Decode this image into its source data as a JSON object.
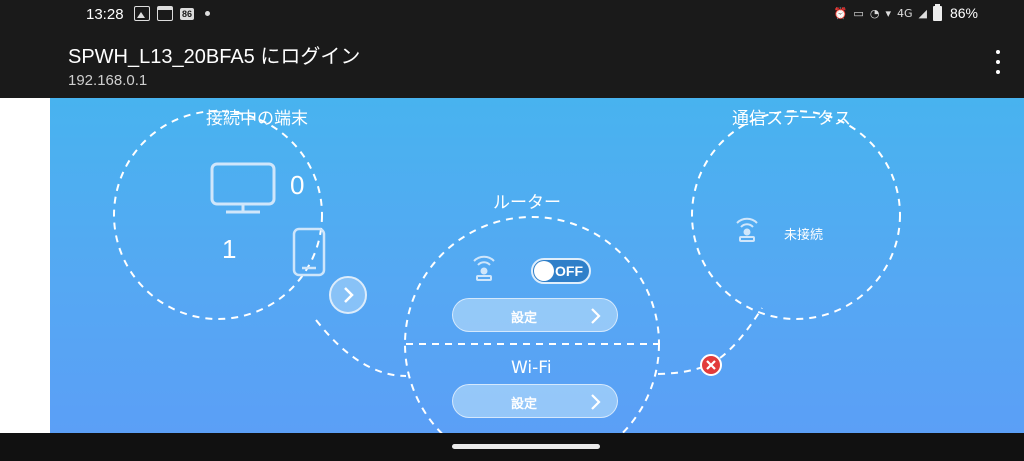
{
  "status_bar": {
    "time": "13:28",
    "badge": "86",
    "network": "4G",
    "battery": "86%"
  },
  "header": {
    "title": "SPWH_L13_20BFA5 にログイン",
    "subtitle": "192.168.0.1"
  },
  "devices": {
    "title": "接続中の端末",
    "pc_count": "0",
    "phone_count": "1"
  },
  "router": {
    "title": "ルーター",
    "toggle_label": "OFF",
    "settings_label": "設定"
  },
  "wifi": {
    "title": "Wi-Fi",
    "settings_label": "設定"
  },
  "status": {
    "title": "通信ステータス",
    "state": "未接続"
  },
  "colors": {
    "background_top": "#48b3ef",
    "background_bottom": "#5b9ff6",
    "error": "#e23b3b"
  }
}
